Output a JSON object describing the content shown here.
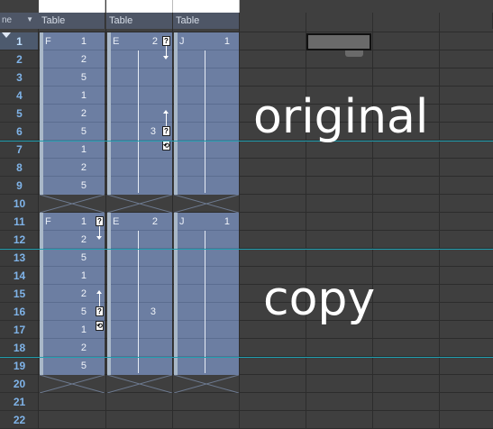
{
  "header": {
    "corner_label": "ne",
    "corner_dropdown": "▼",
    "columns": [
      "Table",
      "Table",
      "Table",
      "",
      "",
      "",
      ""
    ]
  },
  "rows": [
    "1",
    "2",
    "3",
    "4",
    "5",
    "6",
    "7",
    "8",
    "9",
    "10",
    "11",
    "12",
    "13",
    "14",
    "15",
    "16",
    "17",
    "18",
    "19",
    "20",
    "21",
    "22"
  ],
  "selected_row": "1",
  "clips_top": [
    {
      "label": "F",
      "first": "1",
      "values": [
        "1",
        "2",
        "5",
        "1",
        "2",
        "5",
        "1",
        "2",
        "5"
      ]
    },
    {
      "label": "E",
      "first": "2",
      "mid_value": "3"
    },
    {
      "label": "J",
      "first": "1"
    }
  ],
  "clips_bottom": [
    {
      "label": "F",
      "first": "1",
      "values": [
        "1",
        "2",
        "5",
        "1",
        "2",
        "5",
        "1",
        "2",
        "5"
      ]
    },
    {
      "label": "E",
      "first": "2",
      "mid_value": "3"
    },
    {
      "label": "J",
      "first": "1"
    }
  ],
  "annotations": {
    "original": "original",
    "copy": "copy"
  },
  "icons": {
    "lock": "lock-icon",
    "link": "link-icon"
  }
}
